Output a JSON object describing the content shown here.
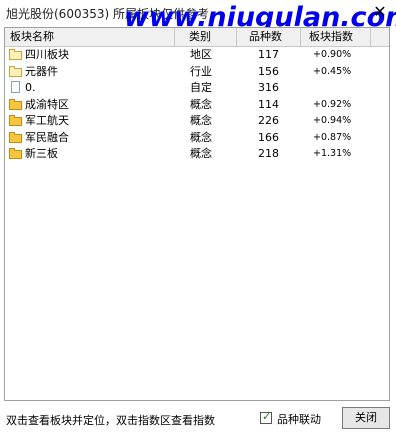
{
  "window": {
    "title": "旭光股份(600353)  所属板块仅供参考",
    "watermark": "www.niugulan.com",
    "close_glyph": "✕"
  },
  "table": {
    "headers": {
      "name": "板块名称",
      "type": "类别",
      "count": "品种数",
      "index": "板块指数"
    },
    "rows": [
      {
        "icon": "folder-open-icon",
        "name": "四川板块",
        "type": "地区",
        "count": "117",
        "index": "+0.90%"
      },
      {
        "icon": "folder-open-icon",
        "name": "元器件",
        "type": "行业",
        "count": "156",
        "index": "+0.45%"
      },
      {
        "icon": "document-icon",
        "name": "0.",
        "type": "自定",
        "count": "316",
        "index": ""
      },
      {
        "icon": "folder-closed-icon",
        "name": "成渝特区",
        "type": "概念",
        "count": "114",
        "index": "+0.92%"
      },
      {
        "icon": "folder-closed-icon",
        "name": "军工航天",
        "type": "概念",
        "count": "226",
        "index": "+0.94%"
      },
      {
        "icon": "folder-closed-icon",
        "name": "军民融合",
        "type": "概念",
        "count": "166",
        "index": "+0.87%"
      },
      {
        "icon": "folder-closed-icon",
        "name": "新三板",
        "type": "概念",
        "count": "218",
        "index": "+1.31%"
      }
    ]
  },
  "status": {
    "hint": "双击查看板块并定位，双击指数区查看指数",
    "linkage_checked": true,
    "linkage_label": "品种联动",
    "close_button": "关闭"
  }
}
